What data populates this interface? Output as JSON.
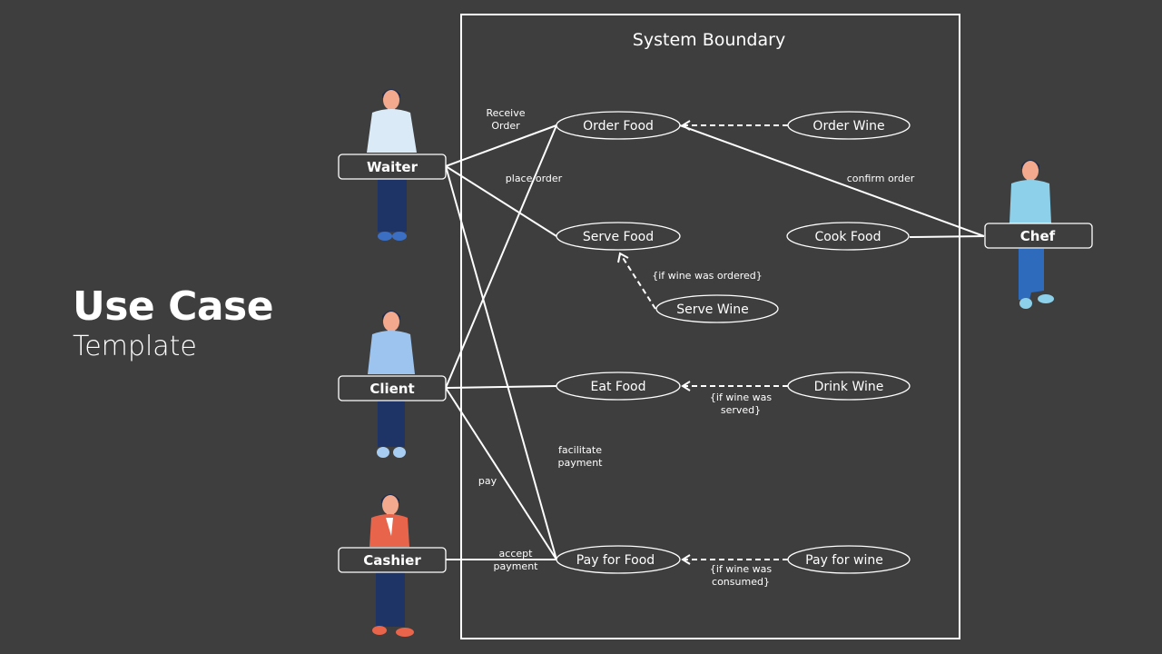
{
  "title": {
    "main": "Use Case",
    "sub": "Template"
  },
  "system_boundary": {
    "label": "System Boundary"
  },
  "actors": [
    {
      "id": "waiter",
      "label": "Waiter",
      "shirt": "#dbeaf7",
      "pants": "#1f3466",
      "shoes": "#3b6fc4",
      "hair": "#1e2a4a"
    },
    {
      "id": "client",
      "label": "Client",
      "shirt": "#9cc4ef",
      "pants": "#1f3466",
      "shoes": "#a8cdf2",
      "hair": "#1e2a4a"
    },
    {
      "id": "cashier",
      "label": "Cashier",
      "shirt": "#e8644a",
      "pants": "#1f3466",
      "shoes": "#e8644a",
      "hair": "#1e2a4a"
    },
    {
      "id": "chef",
      "label": "Chef",
      "shirt": "#8dd0ea",
      "pants": "#2f6bbd",
      "shoes": "#8dd0ea",
      "hair": "#1e2a4a"
    }
  ],
  "use_cases": [
    {
      "id": "order-food",
      "label": "Order Food"
    },
    {
      "id": "order-wine",
      "label": "Order Wine"
    },
    {
      "id": "serve-food",
      "label": "Serve Food"
    },
    {
      "id": "cook-food",
      "label": "Cook Food"
    },
    {
      "id": "serve-wine",
      "label": "Serve Wine"
    },
    {
      "id": "eat-food",
      "label": "Eat Food"
    },
    {
      "id": "drink-wine",
      "label": "Drink Wine"
    },
    {
      "id": "pay-for-food",
      "label": "Pay for Food"
    },
    {
      "id": "pay-for-wine",
      "label": "Pay for wine"
    }
  ],
  "associations": [
    {
      "from": "waiter",
      "to": "order-food"
    },
    {
      "from": "waiter",
      "to": "serve-food"
    },
    {
      "from": "waiter",
      "to": "pay-for-food"
    },
    {
      "from": "client",
      "to": "order-food"
    },
    {
      "from": "client",
      "to": "eat-food"
    },
    {
      "from": "client",
      "to": "pay-for-food"
    },
    {
      "from": "cashier",
      "to": "pay-for-food"
    },
    {
      "from": "chef",
      "to": "order-food"
    },
    {
      "from": "chef",
      "to": "cook-food"
    }
  ],
  "extensions": [
    {
      "from": "order-wine",
      "to": "order-food",
      "condition": ""
    },
    {
      "from": "serve-wine",
      "to": "serve-food",
      "condition": "{if wine was ordered}"
    },
    {
      "from": "drink-wine",
      "to": "eat-food",
      "condition_lines": [
        "{if wine was",
        "served}"
      ]
    },
    {
      "from": "pay-for-wine",
      "to": "pay-for-food",
      "condition_lines": [
        "{if wine was",
        "consumed}"
      ]
    }
  ],
  "annotations": {
    "receive_order": [
      "Receive",
      "Order"
    ],
    "place_order": "place order",
    "confirm_order": "confirm order",
    "facilitate_payment": [
      "facilitate",
      "payment"
    ],
    "pay": "pay",
    "accept_payment": [
      "accept",
      "payment"
    ]
  }
}
